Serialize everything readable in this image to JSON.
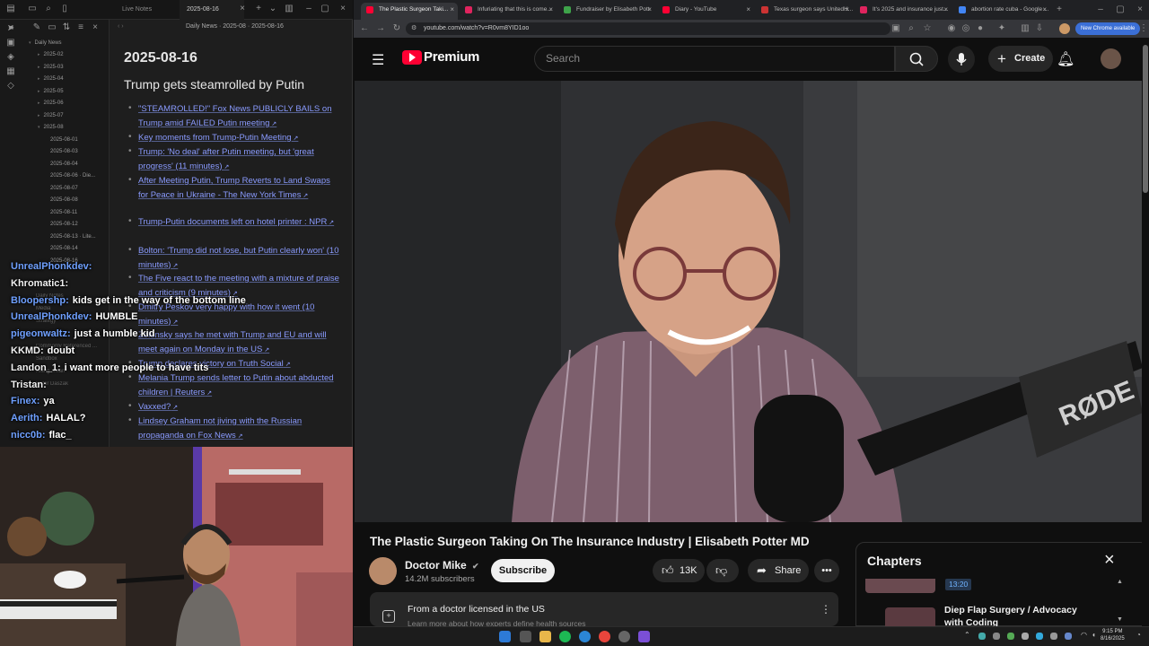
{
  "notes_app": {
    "tabs": [
      {
        "label": "Live Notes"
      },
      {
        "label": "2025-08-16"
      }
    ],
    "breadcrumb": {
      "nav": "‹ ›",
      "path": "Daily News  ·  2025-08  ·  2025-08-16"
    },
    "sidebar": {
      "root": "Daily News",
      "items": [
        "2025-02",
        "2025-03",
        "2025-04",
        "2025-05",
        "2025-06",
        "2025-07",
        "2025-08",
        "2025-08-01",
        "2025-08-03",
        "2025-08-04",
        "2025-08-06 · Die...",
        "2025-08-07",
        "2025-08-08",
        "2025-08-11",
        "2025-08-12",
        "2025-08-13 · Lite...",
        "2025-08-14",
        "2025-08-16"
      ],
      "lower_items": [
        "Daily Notes",
        "Media",
        "Strategy",
        "Templates",
        "Commonly Referenced ...",
        "Sandbox",
        "Xiang Jixian",
        "Peter Daszak"
      ]
    },
    "doc": {
      "date_heading": "2025-08-16",
      "section_heading": "Trump gets steamrolled by Putin",
      "links": [
        "\"STEAMROLLED!\" Fox News PUBLICLY BAILS on Trump amid FAILED Putin meeting",
        "Key moments from Trump-Putin Meeting",
        "Trump: 'No deal' after Putin meeting, but 'great progress' (11 minutes)",
        "After Meeting Putin, Trump Reverts to Land Swaps for Peace in Ukraine - The New York Times",
        "Trump-Putin documents left on hotel printer : NPR",
        "Bolton: 'Trump did not lose, but Putin clearly won' (10 minutes)",
        "The Five react to the meeting with a mixture of praise and criticism (9 minutes)",
        "Dmitry Peskov very happy with how it went (10 minutes)",
        "Zelensky says he met with Trump and EU and will meet again on Monday in the US",
        "Trump declares victory on Truth Social",
        "Melania Trump sends letter to Putin about abducted children | Reuters",
        "Vaxxed?",
        "Lindsey Graham not jiving with the Russian propaganda on Fox News"
      ]
    }
  },
  "chat": [
    {
      "user": "UnrealPhonkdev:",
      "message": "",
      "color": "#6fa0ff"
    },
    {
      "user": "Khromatic1:",
      "message": "",
      "color": "#f0f0f0"
    },
    {
      "user": "Bloopershp:",
      "message": "kids get in the way of the bottom line",
      "color": "#6fa0ff"
    },
    {
      "user": "UnrealPhonkdev:",
      "message": "HUMBLE",
      "color": "#6fa0ff"
    },
    {
      "user": "pigeonwaltz:",
      "message": "just a humble kid",
      "color": "#6fa0ff"
    },
    {
      "user": "KKMD:",
      "message": "doubt",
      "color": "#f0f0f0"
    },
    {
      "user": "Landon_1:",
      "message": "i want more people to have tits",
      "color": "#f0f0f0"
    },
    {
      "user": "Tristan:",
      "message": "",
      "color": "#f0f0f0"
    },
    {
      "user": "Finex:",
      "message": "ya",
      "color": "#6fa0ff"
    },
    {
      "user": "Aerith:",
      "message": "HALAL?",
      "color": "#6fa0ff"
    },
    {
      "user": "nicc0b:",
      "message": "flac_",
      "color": "#6fa0ff"
    }
  ],
  "browser": {
    "tabs": [
      {
        "label": "The Plastic Surgeon Taki...",
        "color": "#ff0033"
      },
      {
        "label": "Infuriating that this is come...",
        "color": "#e0245e"
      },
      {
        "label": "Fundraiser by Elisabeth Pott",
        "color": "#3ea34a"
      },
      {
        "label": "Diary - YouTube",
        "color": "#ff0033"
      },
      {
        "label": "Texas surgeon says UnitedH...",
        "color": "#c33"
      },
      {
        "label": "It's 2025 and insurance just...",
        "color": "#e0245e"
      },
      {
        "label": "abortion rate cuba - Google ...",
        "color": "#4285f4"
      }
    ],
    "url": "youtube.com/watch?v=R0vm8YID1oo",
    "chrome_badge": "New Chrome available"
  },
  "youtube": {
    "logo_text": "Premium",
    "search_placeholder": "Search",
    "create_label": "Create",
    "video_title": "The Plastic Surgeon Taking On The Insurance Industry | Elisabeth Potter MD",
    "channel_name": "Doctor Mike",
    "subscribers": "14.2M subscribers",
    "subscribe_label": "Subscribe",
    "likes": "13K",
    "share_label": "Share",
    "info_text": "From a doctor licensed in the US",
    "info_subtext": "Learn more about how experts define health sources",
    "chapters": {
      "title": "Chapters",
      "items": [
        {
          "time": "13:20",
          "title": ""
        },
        {
          "time": "",
          "title": "Diep Flap Surgery / Advocacy with Coding"
        }
      ]
    },
    "mic_brand": "RØDE"
  },
  "taskbar": {
    "time": "9:15 PM",
    "date": "8/16/2025"
  }
}
